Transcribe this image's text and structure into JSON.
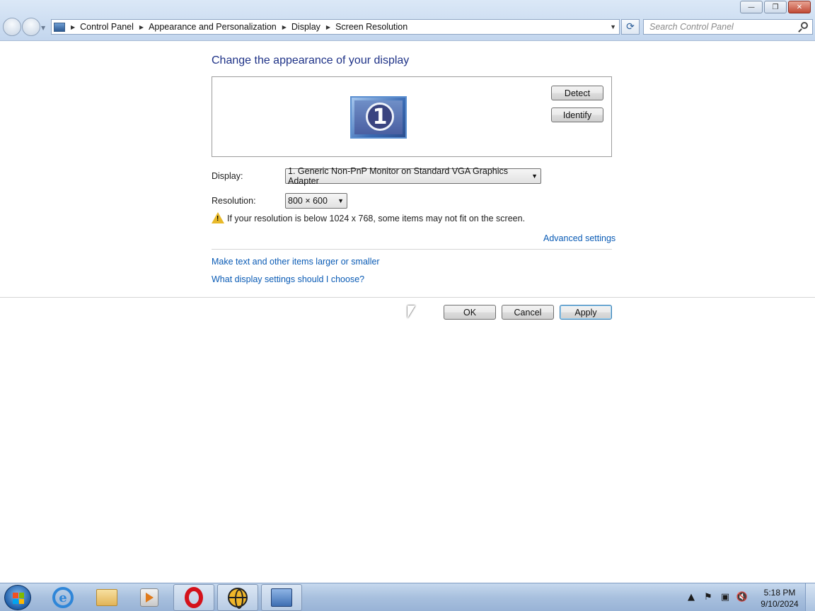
{
  "window": {
    "controls": {
      "minimize": "—",
      "maximize": "❐",
      "close": "✕"
    }
  },
  "nav": {
    "breadcrumb": [
      "Control Panel",
      "Appearance and Personalization",
      "Display",
      "Screen Resolution"
    ],
    "search_placeholder": "Search Control Panel"
  },
  "main": {
    "heading": "Change the appearance of your display",
    "detect_label": "Detect",
    "identify_label": "Identify",
    "monitor_number": "1",
    "display_label": "Display:",
    "display_value": "1. Generic Non-PnP Monitor on Standard VGA Graphics Adapter",
    "resolution_label": "Resolution:",
    "resolution_value": "800 × 600",
    "warning_text": "If your resolution is below 1024 x 768, some items may not fit on the screen.",
    "advanced_link": "Advanced settings",
    "links": [
      "Make text and other items larger or smaller",
      "What display settings should I choose?"
    ]
  },
  "buttons": {
    "ok": "OK",
    "cancel": "Cancel",
    "apply": "Apply"
  },
  "taskbar": {
    "items": [
      "start-button",
      "internet-explorer-icon",
      "windows-explorer-icon",
      "media-player-icon",
      "opera-icon",
      "globe-app-icon",
      "control-panel-icon"
    ],
    "clock_time": "5:18 PM",
    "clock_date": "9/10/2024"
  },
  "colors": {
    "heading": "#1e3287",
    "link": "#0a5bb5",
    "taskbar": "#a8c0de"
  }
}
